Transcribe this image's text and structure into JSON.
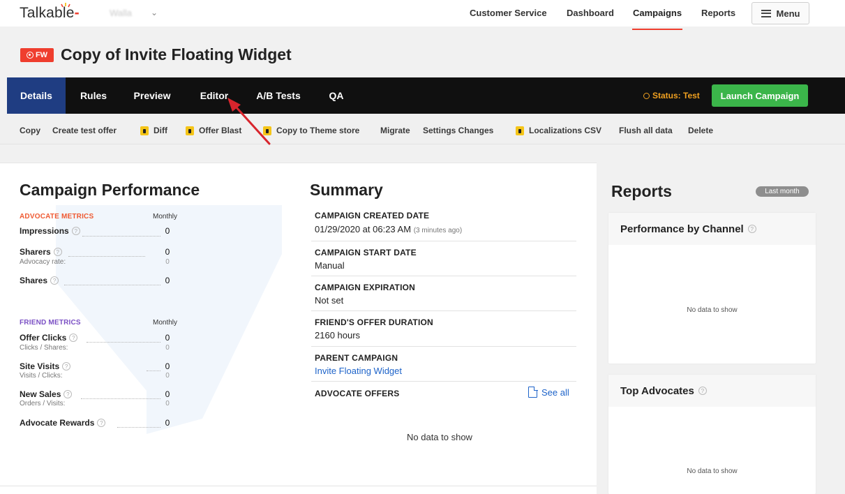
{
  "header": {
    "logo": "Talkable",
    "site_name": "Walla",
    "nav": [
      "Customer Service",
      "Dashboard",
      "Campaigns",
      "Reports"
    ],
    "active_nav": "Campaigns",
    "menu_label": "Menu"
  },
  "campaign": {
    "badge": "FW",
    "title": "Copy of Invite Floating Widget"
  },
  "tabs": [
    "Details",
    "Rules",
    "Preview",
    "Editor",
    "A/B Tests",
    "QA"
  ],
  "active_tab": "Details",
  "status_text": "Status: Test",
  "launch_label": "Launch Campaign",
  "actions": [
    "Copy",
    "Create test offer",
    "Diff",
    "Offer Blast",
    "Copy to Theme store",
    "Migrate",
    "Settings Changes",
    "Localizations CSV",
    "Flush all data",
    "Delete"
  ],
  "performance": {
    "title": "Campaign Performance",
    "advocate_head": "ADVOCATE METRICS",
    "friend_head": "FRIEND METRICS",
    "period": "Monthly",
    "advocate": [
      {
        "label": "Impressions",
        "value": "0"
      },
      {
        "label": "Sharers",
        "value": "0",
        "sub": "Advocacy rate:",
        "sub_value": "0"
      },
      {
        "label": "Shares",
        "value": "0"
      }
    ],
    "friend": [
      {
        "label": "Offer Clicks",
        "value": "0",
        "sub": "Clicks / Shares:",
        "sub_value": "0"
      },
      {
        "label": "Site Visits",
        "value": "0",
        "sub": "Visits / Clicks:",
        "sub_value": "0"
      },
      {
        "label": "New Sales",
        "value": "0",
        "sub": "Orders / Visits:",
        "sub_value": "0"
      },
      {
        "label": "Advocate Rewards",
        "value": "0"
      }
    ]
  },
  "summary": {
    "title": "Summary",
    "rows": [
      {
        "label": "CAMPAIGN CREATED DATE",
        "value": "01/29/2020 at 06:23 AM",
        "note": "(3 minutes ago)"
      },
      {
        "label": "CAMPAIGN START DATE",
        "value": "Manual"
      },
      {
        "label": "CAMPAIGN EXPIRATION",
        "value": "Not set"
      },
      {
        "label": "FRIEND'S OFFER DURATION",
        "value": "2160 hours"
      },
      {
        "label": "PARENT CAMPAIGN",
        "value": "Invite Floating Widget"
      }
    ],
    "offers_label": "ADVOCATE OFFERS",
    "see_all": "See all",
    "empty": "No data to show"
  },
  "reports": {
    "title": "Reports",
    "period": "Last month",
    "cards": [
      {
        "title": "Performance by Channel",
        "empty": "No data to show"
      },
      {
        "title": "Top Advocates",
        "empty": "No data to show"
      }
    ]
  },
  "colors": {
    "brand_red": "#ef3e2e",
    "tab_active": "#1f3d82",
    "launch_green": "#3bb54a",
    "status_orange": "#f0a020",
    "link_blue": "#1d63c9"
  }
}
